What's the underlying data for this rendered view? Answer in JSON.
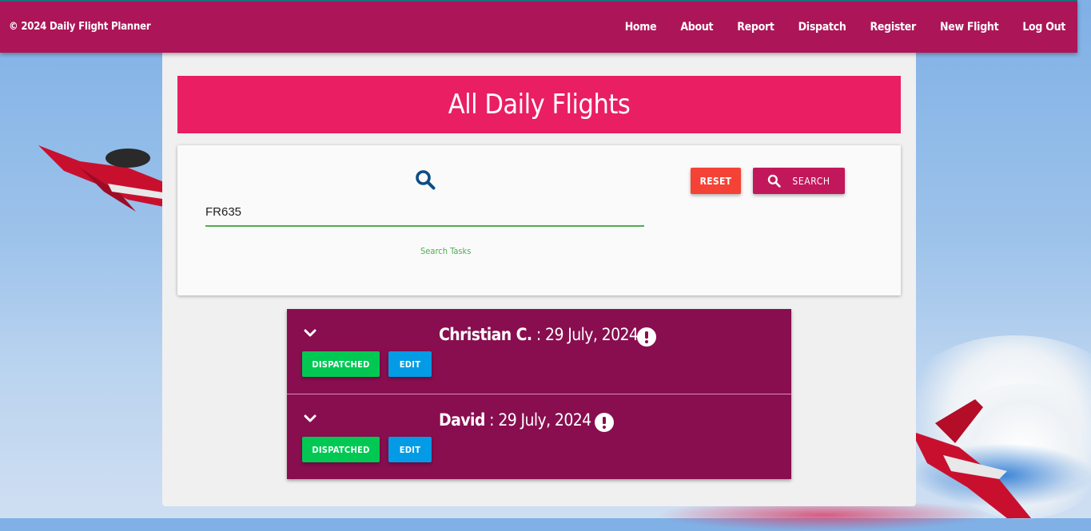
{
  "brand": "© 2024 Daily Flight Planner",
  "nav": [
    "Home",
    "About",
    "Report",
    "Dispatch",
    "Register",
    "New Flight",
    "Log Out"
  ],
  "page_title": "All Daily Flights",
  "search": {
    "value": "FR635",
    "label": "Search Tasks",
    "reset_label": "RESET",
    "search_label": "SEARCH"
  },
  "flights": [
    {
      "name": "Christian C.",
      "date": ": 29 July, 2024",
      "status_label": "DISPATCHED",
      "edit_label": "EDIT"
    },
    {
      "name": "David",
      "date": ": 29 July, 2024",
      "status_label": "DISPATCHED",
      "edit_label": "EDIT"
    }
  ],
  "icons": {
    "search": "search-icon",
    "expand": "chevron-down-icon",
    "alert": "exclamation-circle-icon"
  },
  "colors": {
    "topbar": "#ac1557",
    "title_banner": "#e91e63",
    "flight_item": "#880e4f",
    "reset": "#f44336",
    "search_button": "#c2185b",
    "dispatched": "#00c853",
    "edit": "#039be5",
    "input_underline": "#4caf50"
  }
}
